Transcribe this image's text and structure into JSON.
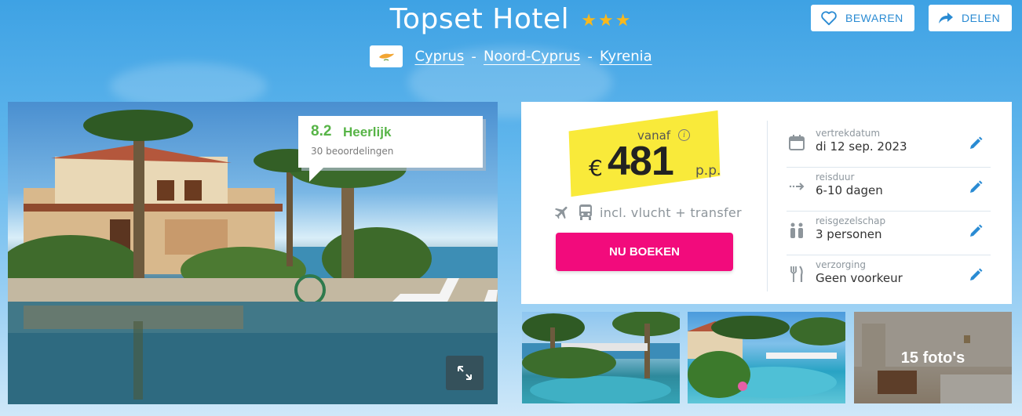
{
  "header": {
    "title": "Topset Hotel",
    "stars": "★★★",
    "star_rating": 3,
    "location": {
      "country": "Cyprus",
      "region": "Noord-Cyprus",
      "city": "Kyrenia",
      "separator": "-"
    },
    "save_label": "BEWAREN",
    "share_label": "DELEN"
  },
  "main_image": {
    "rating_score": "8.2",
    "rating_label": "Heerlijk",
    "rating_count": "30 beoordelingen"
  },
  "booking": {
    "from_label": "vanaf",
    "currency": "€",
    "price": "481",
    "per_person": "p.p.",
    "includes": "incl. vlucht + transfer",
    "book_label": "NU BOEKEN",
    "details": [
      {
        "label": "vertrekdatum",
        "value": "di 12 sep. 2023",
        "icon": "calendar-icon"
      },
      {
        "label": "reisduur",
        "value": "6-10 dagen",
        "icon": "duration-arrow-icon"
      },
      {
        "label": "reisgezelschap",
        "value": "3 personen",
        "icon": "people-icon"
      },
      {
        "label": "verzorging",
        "value": "Geen voorkeur",
        "icon": "cutlery-icon"
      }
    ]
  },
  "gallery": {
    "photo_count_label": "15 foto's"
  },
  "colors": {
    "accent": "#2a8bd3",
    "book_button": "#f20b7c",
    "rating_green": "#57b447",
    "price_highlight": "#f9ea3a",
    "star": "#f8b81c"
  }
}
